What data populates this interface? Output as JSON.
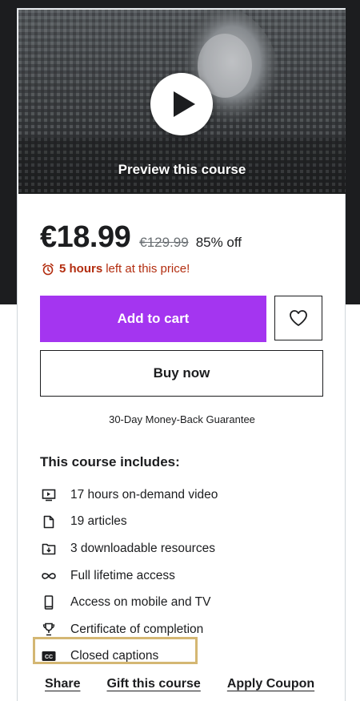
{
  "preview": {
    "label": "Preview this course",
    "play_icon": "play-icon"
  },
  "pricing": {
    "current_price": "€18.99",
    "original_price": "€129.99",
    "discount": "85% off",
    "timer_icon": "alarm-clock-icon",
    "timer_highlight": "5 hours",
    "timer_text": "left at this price!"
  },
  "actions": {
    "add_to_cart_label": "Add to cart",
    "wishlist_icon": "heart-icon",
    "buy_now_label": "Buy now",
    "guarantee": "30-Day Money-Back Guarantee"
  },
  "includes": {
    "title": "This course includes:",
    "items": [
      {
        "icon": "video-icon",
        "label": "17 hours on-demand video"
      },
      {
        "icon": "file-icon",
        "label": "19 articles"
      },
      {
        "icon": "download-folder-icon",
        "label": "3 downloadable resources"
      },
      {
        "icon": "infinity-icon",
        "label": "Full lifetime access"
      },
      {
        "icon": "mobile-icon",
        "label": "Access on mobile and TV"
      },
      {
        "icon": "trophy-icon",
        "label": "Certificate of completion"
      },
      {
        "icon": "closed-captions-icon",
        "label": "Closed captions"
      }
    ]
  },
  "footer": {
    "share_label": "Share",
    "gift_label": "Gift this course",
    "coupon_label": "Apply Coupon"
  },
  "colors": {
    "accent": "#a435f0",
    "timer_red": "#b32d0f",
    "highlight_border": "#d4b773",
    "backdrop": "#1c1d1f"
  }
}
